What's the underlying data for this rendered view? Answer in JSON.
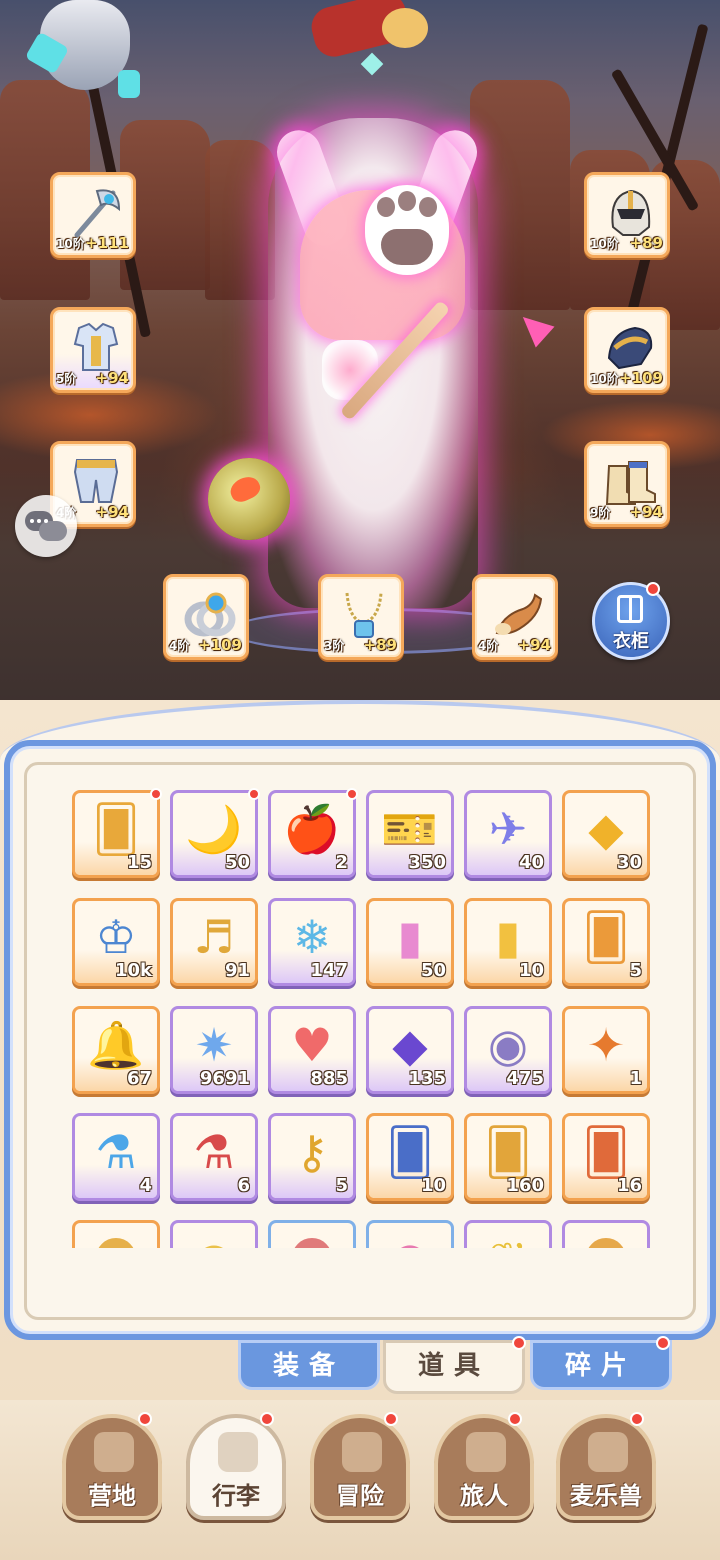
{
  "equipment": {
    "weapon": {
      "icon": "axe-staff-icon",
      "tier": "10阶",
      "bonus": "+111"
    },
    "armor": {
      "icon": "chest-armor-icon",
      "tier": "5阶",
      "bonus": "+94"
    },
    "pants": {
      "icon": "leg-armor-icon",
      "tier": "4阶",
      "bonus": "+94"
    },
    "helmet": {
      "icon": "helmet-icon",
      "tier": "10阶",
      "bonus": "+89"
    },
    "gloves": {
      "icon": "gauntlet-icon",
      "tier": "10阶",
      "bonus": "+109"
    },
    "boots": {
      "icon": "boots-icon",
      "tier": "9阶",
      "bonus": "+94"
    },
    "ring": {
      "icon": "ring-icon",
      "tier": "4阶",
      "bonus": "+109"
    },
    "necklace": {
      "icon": "necklace-icon",
      "tier": "3阶",
      "bonus": "+89"
    },
    "horn": {
      "icon": "horn-icon",
      "tier": "4阶",
      "bonus": "+94"
    }
  },
  "wardrobe": {
    "label": "衣柜",
    "icon": "wardrobe-icon"
  },
  "chat": {
    "icon": "chat-bubbles-icon"
  },
  "inventory": {
    "items": [
      {
        "icon": "golden-card-icon",
        "count": "15",
        "rarity": "orange",
        "new": true
      },
      {
        "icon": "moon-ticket-icon",
        "count": "50",
        "rarity": "purple",
        "new": true
      },
      {
        "icon": "apple-icon",
        "count": "2",
        "rarity": "purple",
        "new": true
      },
      {
        "icon": "purple-ticket-icon",
        "count": "350",
        "rarity": "purple",
        "new": false
      },
      {
        "icon": "paper-plane-icon",
        "count": "40",
        "rarity": "purple",
        "new": false
      },
      {
        "icon": "gold-crystal-icon",
        "count": "30",
        "rarity": "orange",
        "new": false
      },
      {
        "icon": "crown-orb-icon",
        "count": "10k",
        "rarity": "orange",
        "new": false
      },
      {
        "icon": "lyre-icon",
        "count": "91",
        "rarity": "orange",
        "new": false
      },
      {
        "icon": "ice-crystal-icon",
        "count": "147",
        "rarity": "purple",
        "new": false
      },
      {
        "icon": "rainbow-paint-tube-icon",
        "count": "50",
        "rarity": "orange",
        "new": false
      },
      {
        "icon": "gold-paint-tube-icon",
        "count": "10",
        "rarity": "orange",
        "new": false
      },
      {
        "icon": "pet-card-icon",
        "count": "5",
        "rarity": "orange",
        "new": false
      },
      {
        "icon": "bell-icon",
        "count": "67",
        "rarity": "orange",
        "new": false
      },
      {
        "icon": "star-crystal-icon",
        "count": "9691",
        "rarity": "purple",
        "new": false
      },
      {
        "icon": "heart-icon",
        "count": "885",
        "rarity": "purple",
        "new": false
      },
      {
        "icon": "amethyst-icon",
        "count": "135",
        "rarity": "purple",
        "new": false
      },
      {
        "icon": "heart-coin-icon",
        "count": "475",
        "rarity": "purple",
        "new": false
      },
      {
        "icon": "fire-crystal-wand-icon",
        "count": "1",
        "rarity": "orange",
        "new": false
      },
      {
        "icon": "blue-potion-icon",
        "count": "4",
        "rarity": "purple",
        "new": false
      },
      {
        "icon": "red-potion-icon",
        "count": "6",
        "rarity": "purple",
        "new": false
      },
      {
        "icon": "golden-key-icon",
        "count": "5",
        "rarity": "purple",
        "new": false
      },
      {
        "icon": "blue-card-icon",
        "count": "10",
        "rarity": "orange",
        "new": false
      },
      {
        "icon": "gold-card-icon",
        "count": "160",
        "rarity": "orange",
        "new": false
      },
      {
        "icon": "red-card-icon",
        "count": "16",
        "rarity": "orange",
        "new": false
      },
      {
        "icon": "cat-mask-icon",
        "count": "",
        "rarity": "orange",
        "new": false
      },
      {
        "icon": "gold-blob-icon",
        "count": "",
        "rarity": "purple",
        "new": false
      },
      {
        "icon": "plush-icon",
        "count": "",
        "rarity": "blue",
        "new": false
      },
      {
        "icon": "candy-icon",
        "count": "",
        "rarity": "blue",
        "new": false
      },
      {
        "icon": "gold-leaf-icon",
        "count": "",
        "rarity": "purple",
        "new": false
      },
      {
        "icon": "cat-icon",
        "count": "",
        "rarity": "purple",
        "new": false
      }
    ]
  },
  "tabs": {
    "equipment": "装备",
    "items": "道具",
    "shards": "碎片"
  },
  "nav": {
    "camp": "营地",
    "luggage": "行李",
    "adventure": "冒险",
    "traveler": "旅人",
    "pets": "麦乐兽"
  },
  "colors": {
    "accent_blue": "#6c97e0",
    "slot_orange": "#f4a85a",
    "rarity_purple": "#b08ae2",
    "notify_red": "#f0463c"
  }
}
